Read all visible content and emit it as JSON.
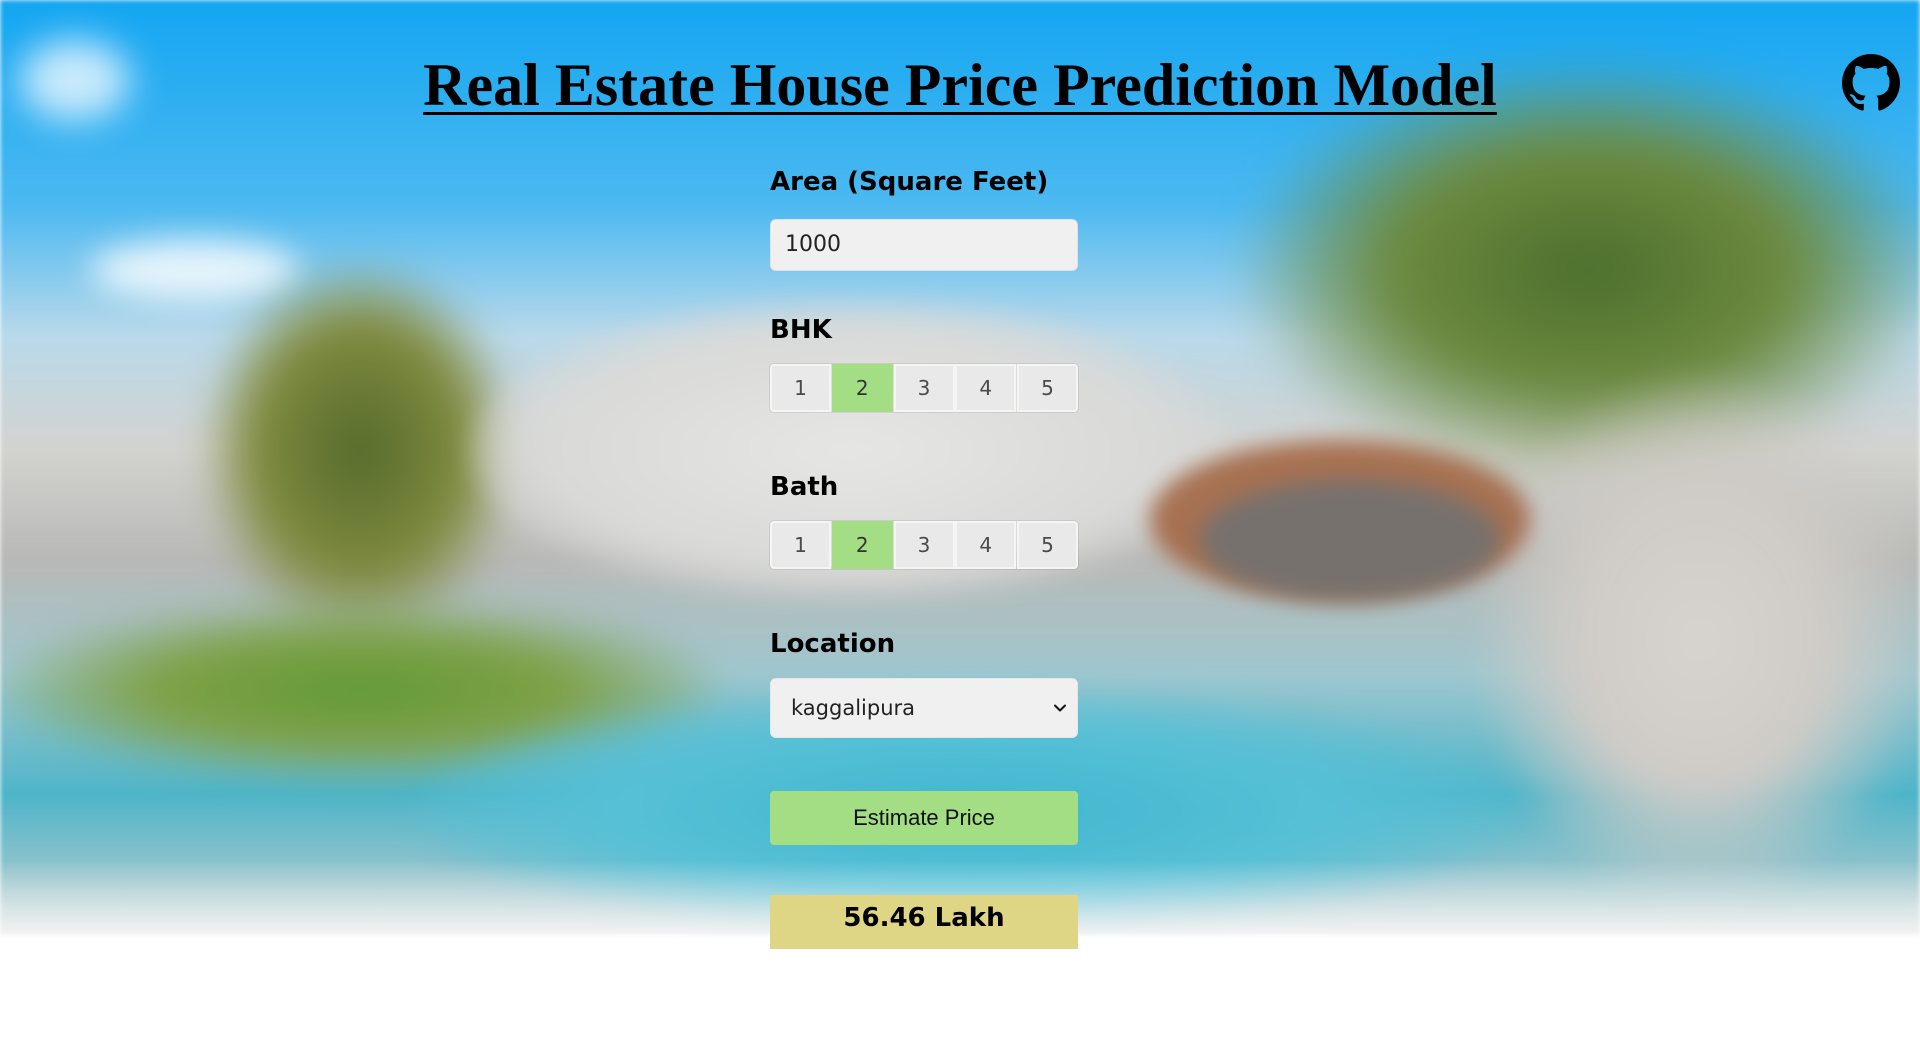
{
  "header": {
    "title": "Real Estate House Price Prediction Model",
    "github_icon": "github-icon"
  },
  "form": {
    "area": {
      "label": "Area (Square Feet)",
      "value": "1000"
    },
    "bhk": {
      "label": "BHK",
      "options": [
        "1",
        "2",
        "3",
        "4",
        "5"
      ],
      "selected": "2"
    },
    "bath": {
      "label": "Bath",
      "options": [
        "1",
        "2",
        "3",
        "4",
        "5"
      ],
      "selected": "2"
    },
    "location": {
      "label": "Location",
      "selected": "kaggalipura",
      "chevron_icon": "chevron-down-icon"
    },
    "estimate_label": "Estimate Price",
    "result": "56.46 Lakh"
  },
  "colors": {
    "selected_option": "#a3de84",
    "button": "#a3de84",
    "result_background": "#dfd685"
  }
}
